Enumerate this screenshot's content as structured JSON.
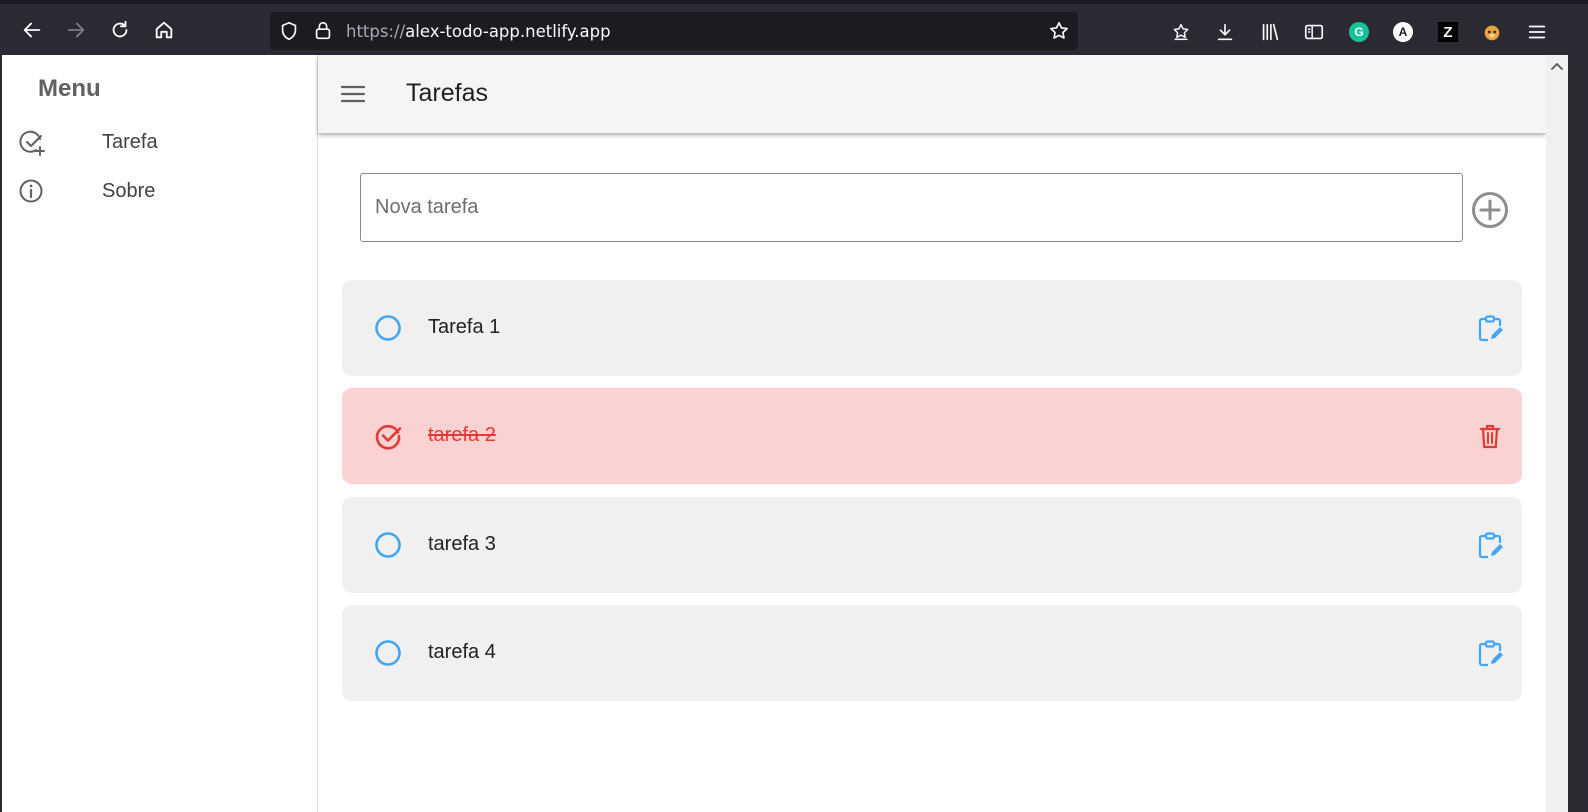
{
  "browser": {
    "url_protocol": "https://",
    "url_host": "alex-todo-app.netlify.app",
    "extensions": [
      "grammarly-icon",
      "a-extension-icon",
      "z-extension-icon",
      "tampermonkey-icon"
    ],
    "ext_a_letter": "A",
    "ext_z_letter": "Z"
  },
  "sidebar": {
    "title": "Menu",
    "items": [
      {
        "label": "Tarefa",
        "icon": "check-plus-icon"
      },
      {
        "label": "Sobre",
        "icon": "info-icon"
      }
    ]
  },
  "header": {
    "title": "Tarefas"
  },
  "new_task": {
    "placeholder": "Nova tarefa",
    "value": ""
  },
  "tasks": [
    {
      "text": "Tarefa 1",
      "done": false,
      "action": "edit"
    },
    {
      "text": "tarefa 2",
      "done": true,
      "action": "delete"
    },
    {
      "text": "tarefa 3",
      "done": false,
      "action": "edit"
    },
    {
      "text": "tarefa 4",
      "done": false,
      "action": "edit"
    }
  ],
  "colors": {
    "accent_blue": "#42a5f5",
    "done_red": "#e53935",
    "done_bg": "#fad2d2",
    "task_bg": "#f0f0f0",
    "browser_bg": "#2b2a33"
  }
}
